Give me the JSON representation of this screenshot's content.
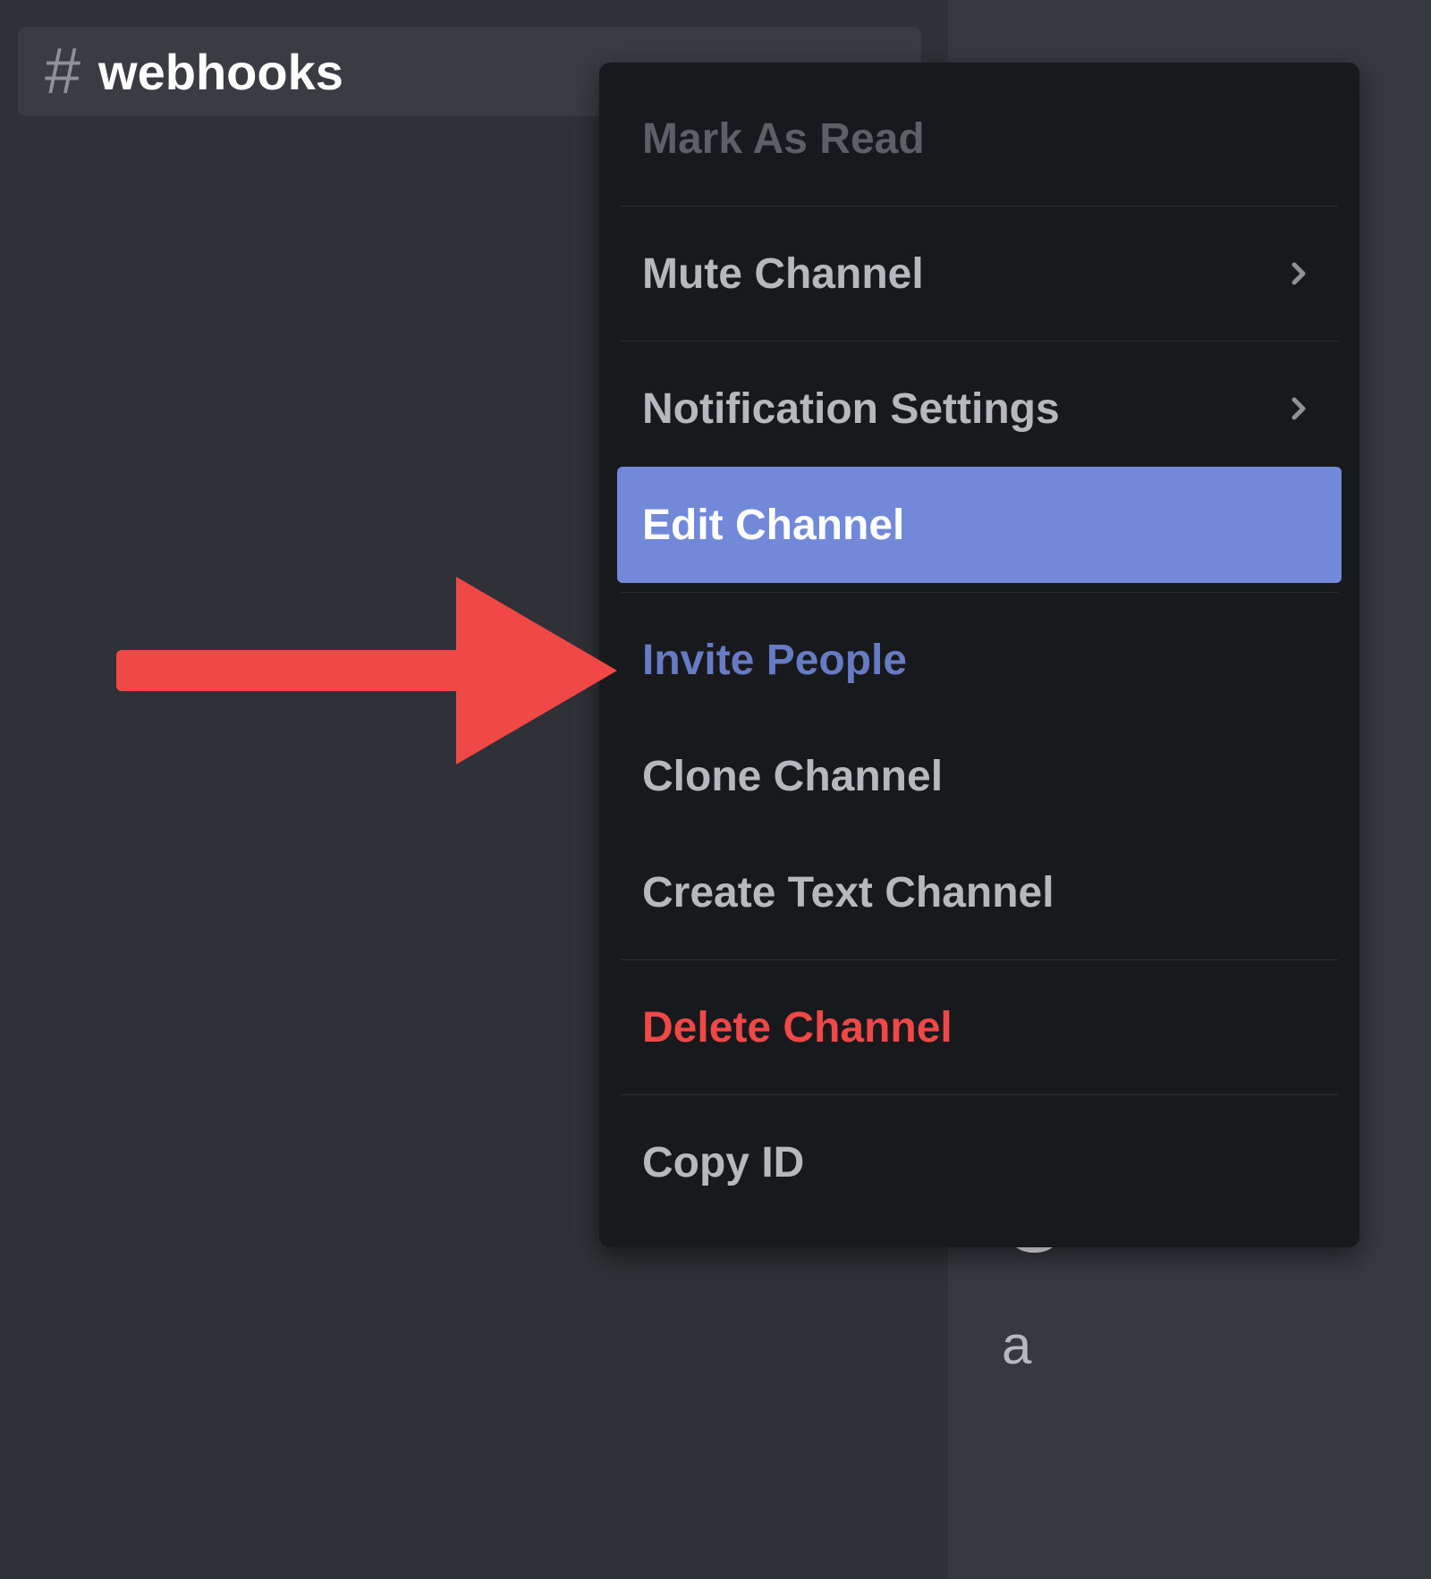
{
  "channel": {
    "name": "webhooks"
  },
  "menu": {
    "mark_as_read": "Mark As Read",
    "mute_channel": "Mute Channel",
    "notification_settings": "Notification Settings",
    "edit_channel": "Edit Channel",
    "invite_people": "Invite People",
    "clone_channel": "Clone Channel",
    "create_text_channel": "Create Text Channel",
    "delete_channel": "Delete Channel",
    "copy_id": "Copy ID"
  },
  "chat": {
    "welcome_fragment": "o",
    "welcome_sub_fragment": "a"
  },
  "colors": {
    "sidebar_bg": "#2f3136",
    "chat_bg": "#36393f",
    "menu_bg": "#18191c",
    "selected_bg": "#7289da",
    "link": "#677bc4",
    "danger": "#f04747",
    "annotation_arrow": "#f04747"
  }
}
